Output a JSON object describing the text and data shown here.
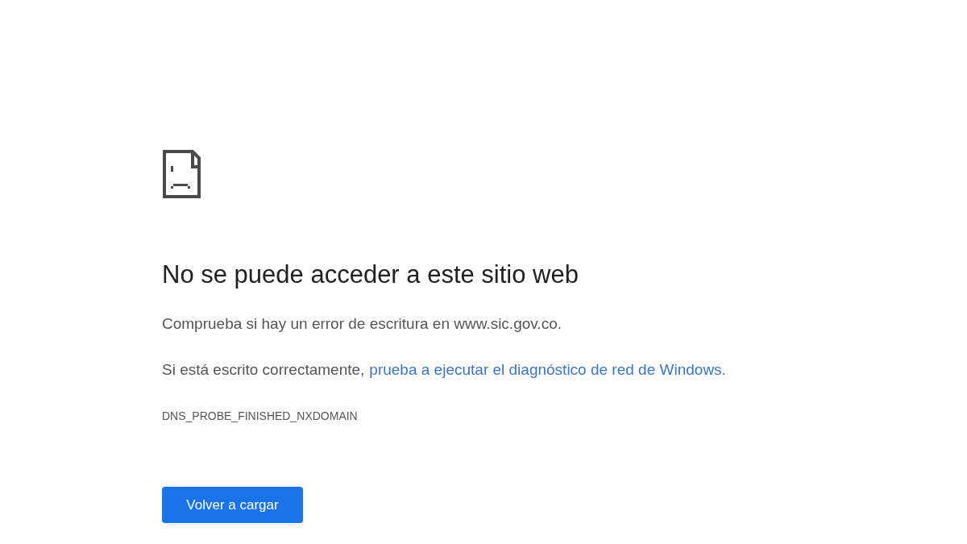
{
  "heading": "No se puede acceder a este sitio web",
  "message": "Comprueba si hay un error de escritura en www.sic.gov.co.",
  "suggestion": {
    "text": "Si está escrito correctamente,",
    "link": "prueba a ejecutar el diagnóstico de red de Windows."
  },
  "error_code": "DNS_PROBE_FINISHED_NXDOMAIN",
  "button": "Volver a cargar"
}
